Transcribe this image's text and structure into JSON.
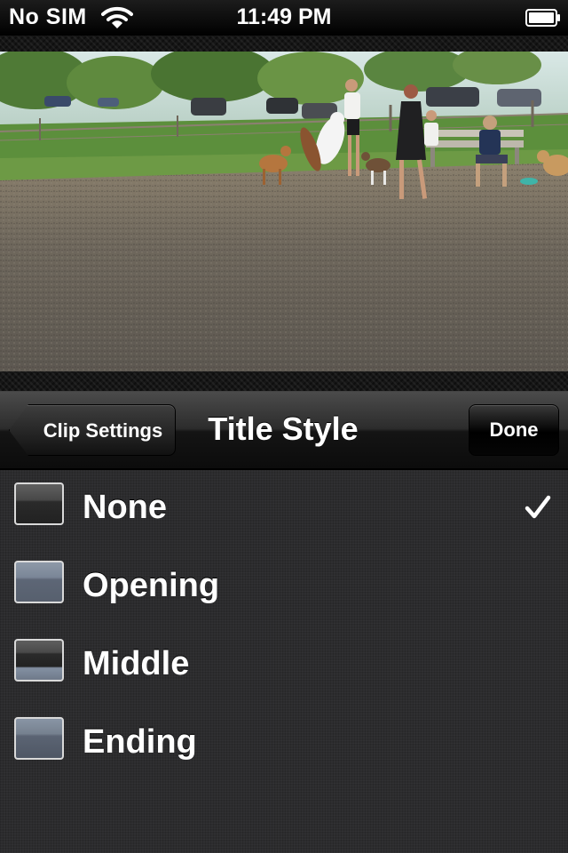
{
  "status_bar": {
    "carrier": "No SIM",
    "time": "11:49 PM",
    "wifi_icon": "wifi-icon",
    "battery_icon": "battery-full-icon"
  },
  "preview": {
    "description_icon": "video-preview"
  },
  "nav": {
    "back_label": "Clip Settings",
    "title": "Title Style",
    "done_label": "Done"
  },
  "options": [
    {
      "label": "None",
      "selected": true
    },
    {
      "label": "Opening",
      "selected": false
    },
    {
      "label": "Middle",
      "selected": false
    },
    {
      "label": "Ending",
      "selected": false
    }
  ],
  "colors": {
    "nav_bar": "#1e1e1e",
    "list_background": "#2c2c2e",
    "text": "#ffffff"
  }
}
